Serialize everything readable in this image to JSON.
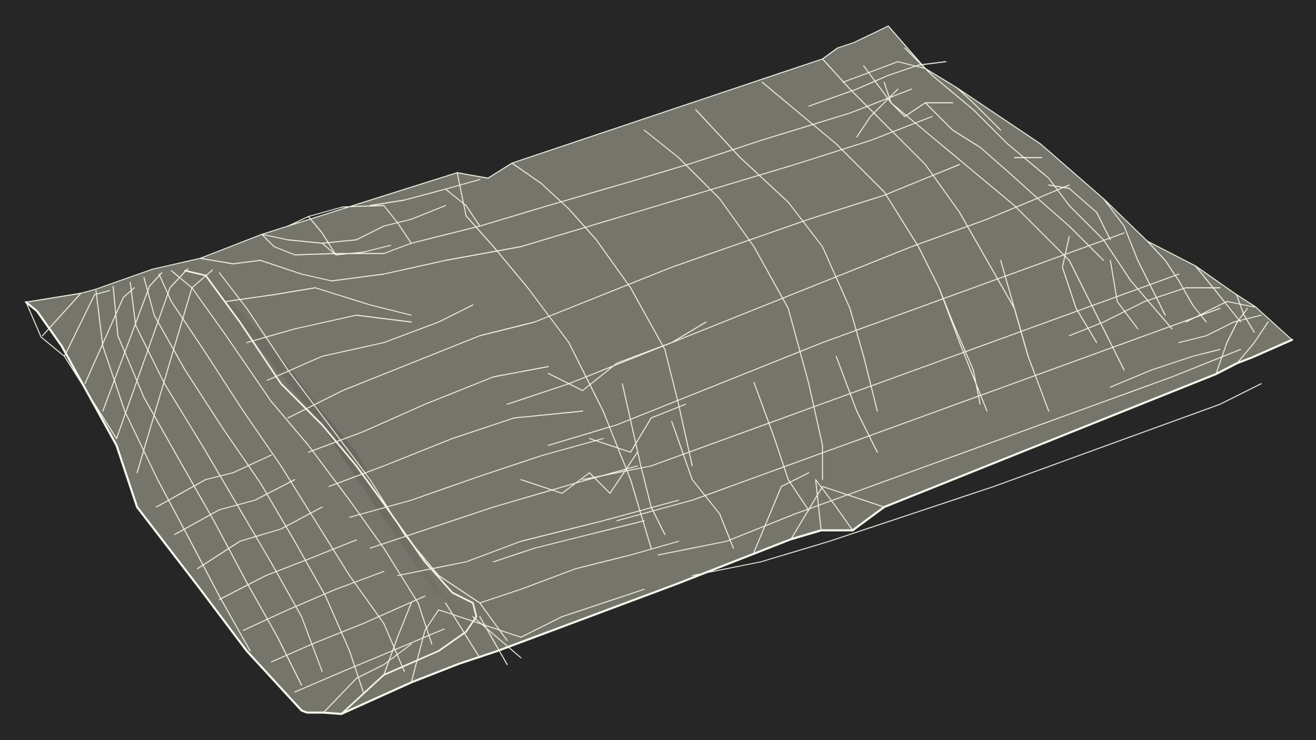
{
  "viewport": {
    "background_color": "#262626",
    "mesh_fill_color": "#75756b",
    "mesh_shadow_color": "#5f5f57",
    "wireframe_color": "#f3f3e6",
    "edge_highlight_color": "#fbfbef"
  }
}
